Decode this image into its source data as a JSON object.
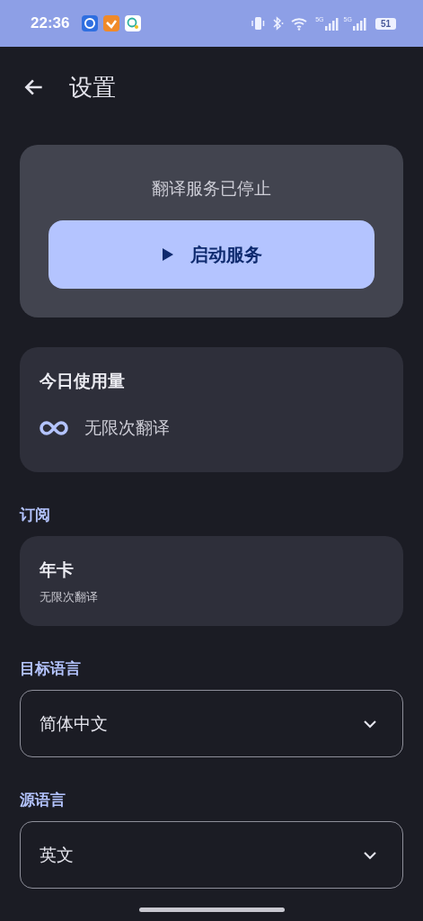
{
  "status_bar": {
    "time": "22:36",
    "networks": [
      "5G",
      "5G"
    ],
    "battery": "51"
  },
  "header": {
    "title": "设置"
  },
  "service_card": {
    "status": "翻译服务已停止",
    "button": "启动服务"
  },
  "usage_card": {
    "title": "今日使用量",
    "value": "无限次翻译"
  },
  "subscription": {
    "label": "订阅",
    "plan": "年卡",
    "description": "无限次翻译"
  },
  "selects": [
    {
      "label": "目标语言",
      "value": "简体中文"
    },
    {
      "label": "源语言",
      "value": "英文"
    }
  ]
}
